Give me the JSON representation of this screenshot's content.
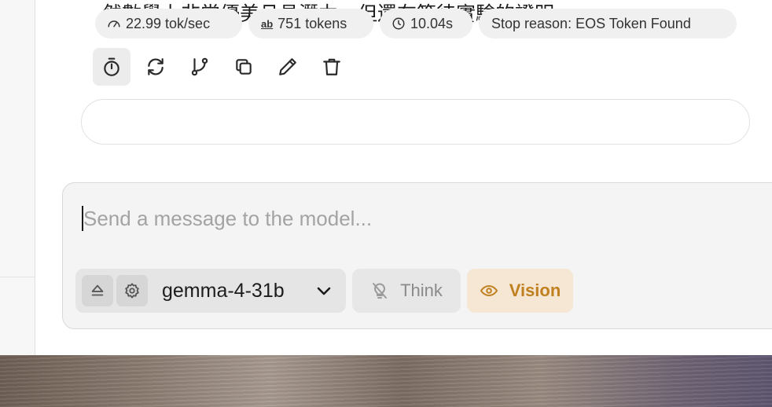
{
  "message": {
    "text_tail": "然數學上非常優美且具潛力，但還在等待實驗的證明。"
  },
  "actions": [
    {
      "icon": "timer-icon"
    },
    {
      "icon": "regenerate-icon"
    },
    {
      "icon": "branch-icon"
    },
    {
      "icon": "copy-icon"
    },
    {
      "icon": "edit-icon"
    },
    {
      "icon": "trash-icon"
    }
  ],
  "stats": {
    "speed": "22.99 tok/sec",
    "tokens_icon_text": "ab",
    "tokens": "751 tokens",
    "time": "10.04s",
    "stop_reason": "Stop reason: EOS Token Found"
  },
  "composer": {
    "placeholder": "Send a message to the model...",
    "value": "",
    "model": "gemma-4-31b",
    "think_label": "Think",
    "vision_label": "Vision"
  },
  "colors": {
    "vision_accent": "#c0801f",
    "vision_bg": "#f5e7d4",
    "pill_bg": "#f0f0f0"
  }
}
